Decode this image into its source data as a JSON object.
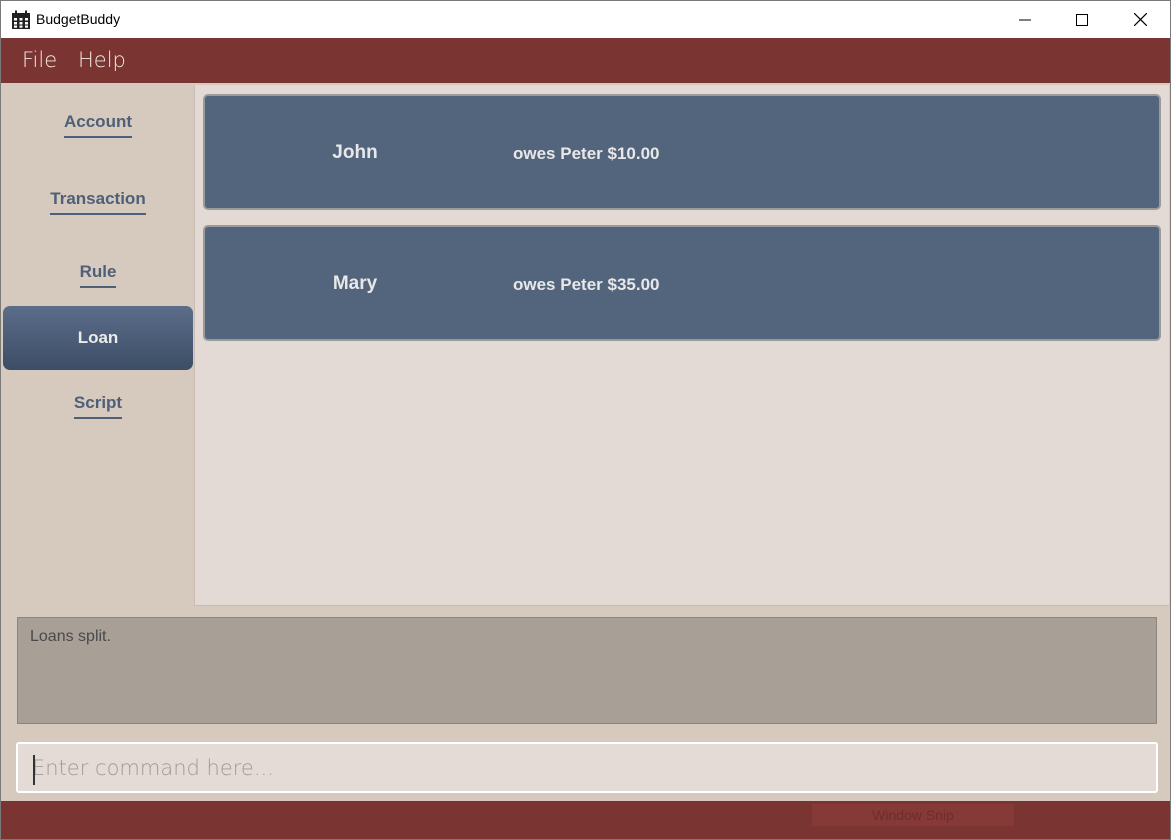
{
  "window": {
    "title": "BudgetBuddy",
    "icon": "calendar-icon",
    "controls": [
      "minimize-icon",
      "maximize-icon",
      "close-icon"
    ]
  },
  "menu": {
    "items": [
      {
        "label": "File"
      },
      {
        "label": "Help"
      }
    ]
  },
  "sidebar": {
    "items": [
      {
        "label": "Account",
        "active": false
      },
      {
        "label": "Transaction",
        "active": false
      },
      {
        "label": "Rule",
        "active": false
      },
      {
        "label": "Loan",
        "active": true
      },
      {
        "label": "Script",
        "active": false
      }
    ]
  },
  "loans": [
    {
      "name": "John",
      "description": "owes Peter $10.00"
    },
    {
      "name": "Mary",
      "description": "owes Peter $35.00"
    }
  ],
  "result": {
    "text": "Loans split."
  },
  "command": {
    "placeholder": "Enter command here...",
    "value": ""
  },
  "status": {
    "snip_label": "Window Snip"
  },
  "colors": {
    "menu_bar": "#7a3533",
    "sidebar_bg": "#d6c9bd",
    "content_bg": "#e3dad5",
    "card_bg": "#52657d",
    "result_bg": "#a89f96",
    "nav_text": "#4e5f78"
  }
}
